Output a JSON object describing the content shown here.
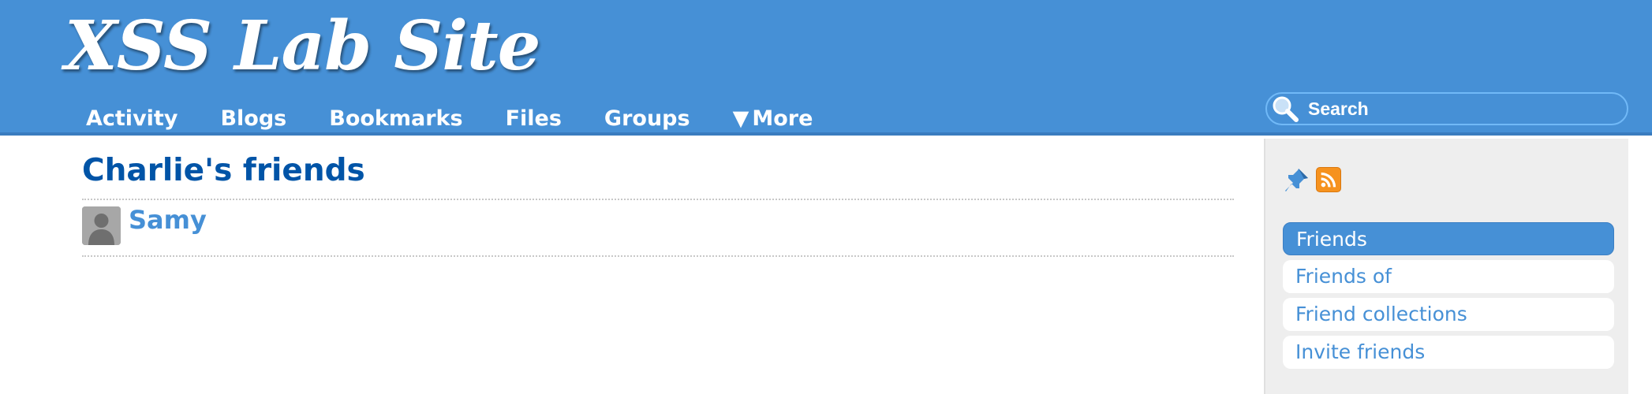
{
  "site": {
    "title": "XSS Lab Site"
  },
  "nav": {
    "items": [
      {
        "label": "Activity"
      },
      {
        "label": "Blogs"
      },
      {
        "label": "Bookmarks"
      },
      {
        "label": "Files"
      },
      {
        "label": "Groups"
      },
      {
        "label": "More",
        "arrow": "▼"
      }
    ]
  },
  "search": {
    "placeholder": "Search",
    "icon": "search-icon"
  },
  "main": {
    "title": "Charlie's friends",
    "friends": [
      {
        "name": "Samy",
        "avatar": "default-user-avatar"
      }
    ]
  },
  "sidebar": {
    "icons": [
      "pin-icon",
      "rss-icon"
    ],
    "menu": [
      {
        "label": "Friends",
        "selected": true
      },
      {
        "label": "Friends of",
        "selected": false
      },
      {
        "label": "Friend collections",
        "selected": false
      },
      {
        "label": "Invite friends",
        "selected": false
      }
    ]
  },
  "colors": {
    "header_bg": "#4690d6",
    "title_blue": "#0054a7",
    "link_blue": "#4690d6",
    "sidebar_bg": "#eeeeee",
    "rss_orange": "#f6921e"
  }
}
